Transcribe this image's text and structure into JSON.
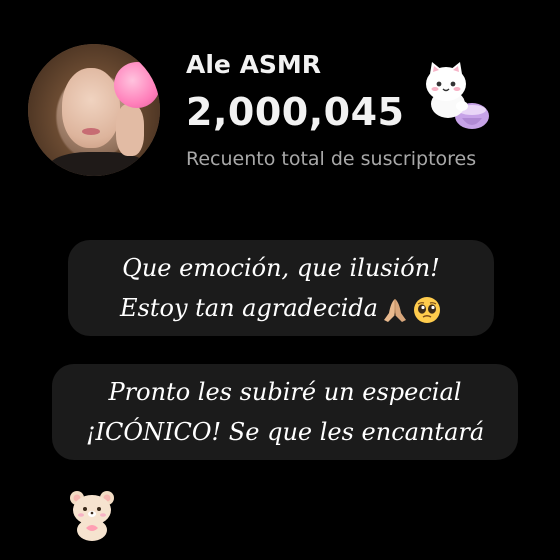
{
  "channel": {
    "name": "Ale ASMR",
    "subscriber_count": "2,000,045",
    "subscriber_label": "Recuento total de suscriptores"
  },
  "captions": [
    {
      "line1": "Que emoción, que ilusión!",
      "line2": "Estoy tan agradecida"
    },
    {
      "line1": "Pronto les subiré un especial",
      "line2": "¡ICÓNICO! Se que les encantará"
    }
  ],
  "icons": {
    "avatar": "profile-photo",
    "cat_sticker": "cat-with-purple-bag-sticker",
    "praying_hands": "praying-hands-emoji",
    "pleading_face": "pleading-face-emoji",
    "bear_sticker": "bear-sticker"
  },
  "colors": {
    "background": "#000000",
    "pill": "#1b1b1b",
    "secondary_text": "#a8a8a8"
  }
}
